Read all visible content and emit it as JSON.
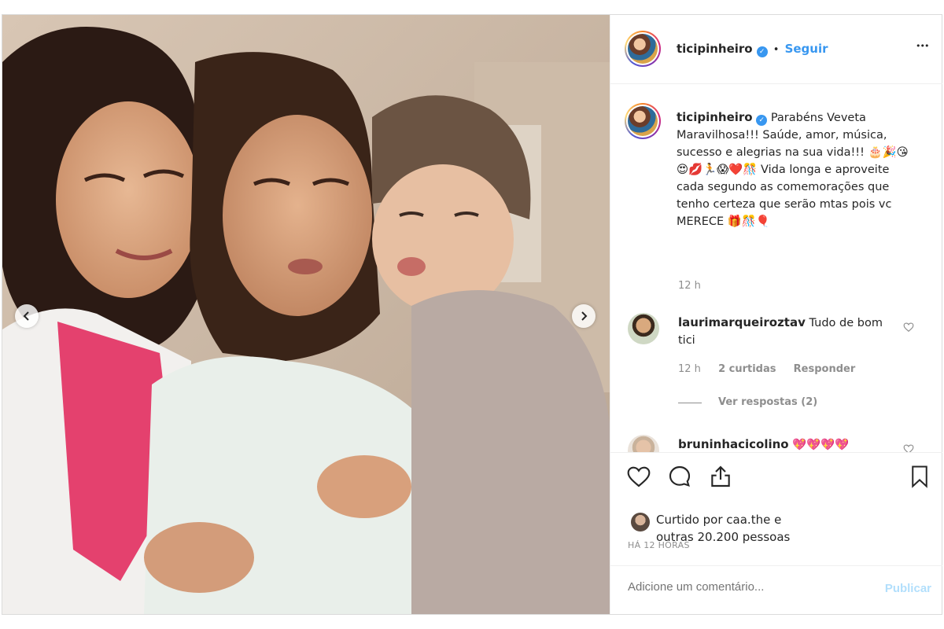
{
  "post": {
    "username": "ticipinheiro",
    "follow_label": "Seguir",
    "dot": "•",
    "more_label": "•••",
    "caption": "Parabéns Veveta Maravilhosa!!! Saúde, amor, música, sucesso e alegrias na sua vida!!! 🎂🎉😘😍💋🏃😱❤️🎊 Vida longa e aproveite cada segundo as comemorações que tenho certeza que serão mtas pois vc MERECE 🎁🎊🎈",
    "caption_time": "12 h",
    "comments": [
      {
        "username": "laurimarqueiroztav",
        "text": "Tudo de bom tici",
        "time": "12 h",
        "likes": "2 curtidas",
        "reply": "Responder",
        "view_replies": "Ver respostas (2)"
      },
      {
        "username": "bruninhacicolino",
        "text": "💖💖💖💖"
      }
    ],
    "liked_by": "Curtido por caa.the e",
    "liked_others": "outras 20.200 pessoas",
    "timestamp": "HÁ 12 HORAS",
    "comment_placeholder": "Adicione um comentário...",
    "publish_label": "Publicar"
  },
  "icons": {
    "prev": "chevron-left-icon",
    "next": "chevron-right-icon",
    "like": "heart-icon",
    "comment": "comment-icon",
    "share": "share-icon",
    "save": "bookmark-icon"
  },
  "colors": {
    "accent": "#3897f0",
    "muted": "#8e8e8e",
    "border": "#dbdbdb",
    "publish_disabled": "#b2dffc"
  }
}
